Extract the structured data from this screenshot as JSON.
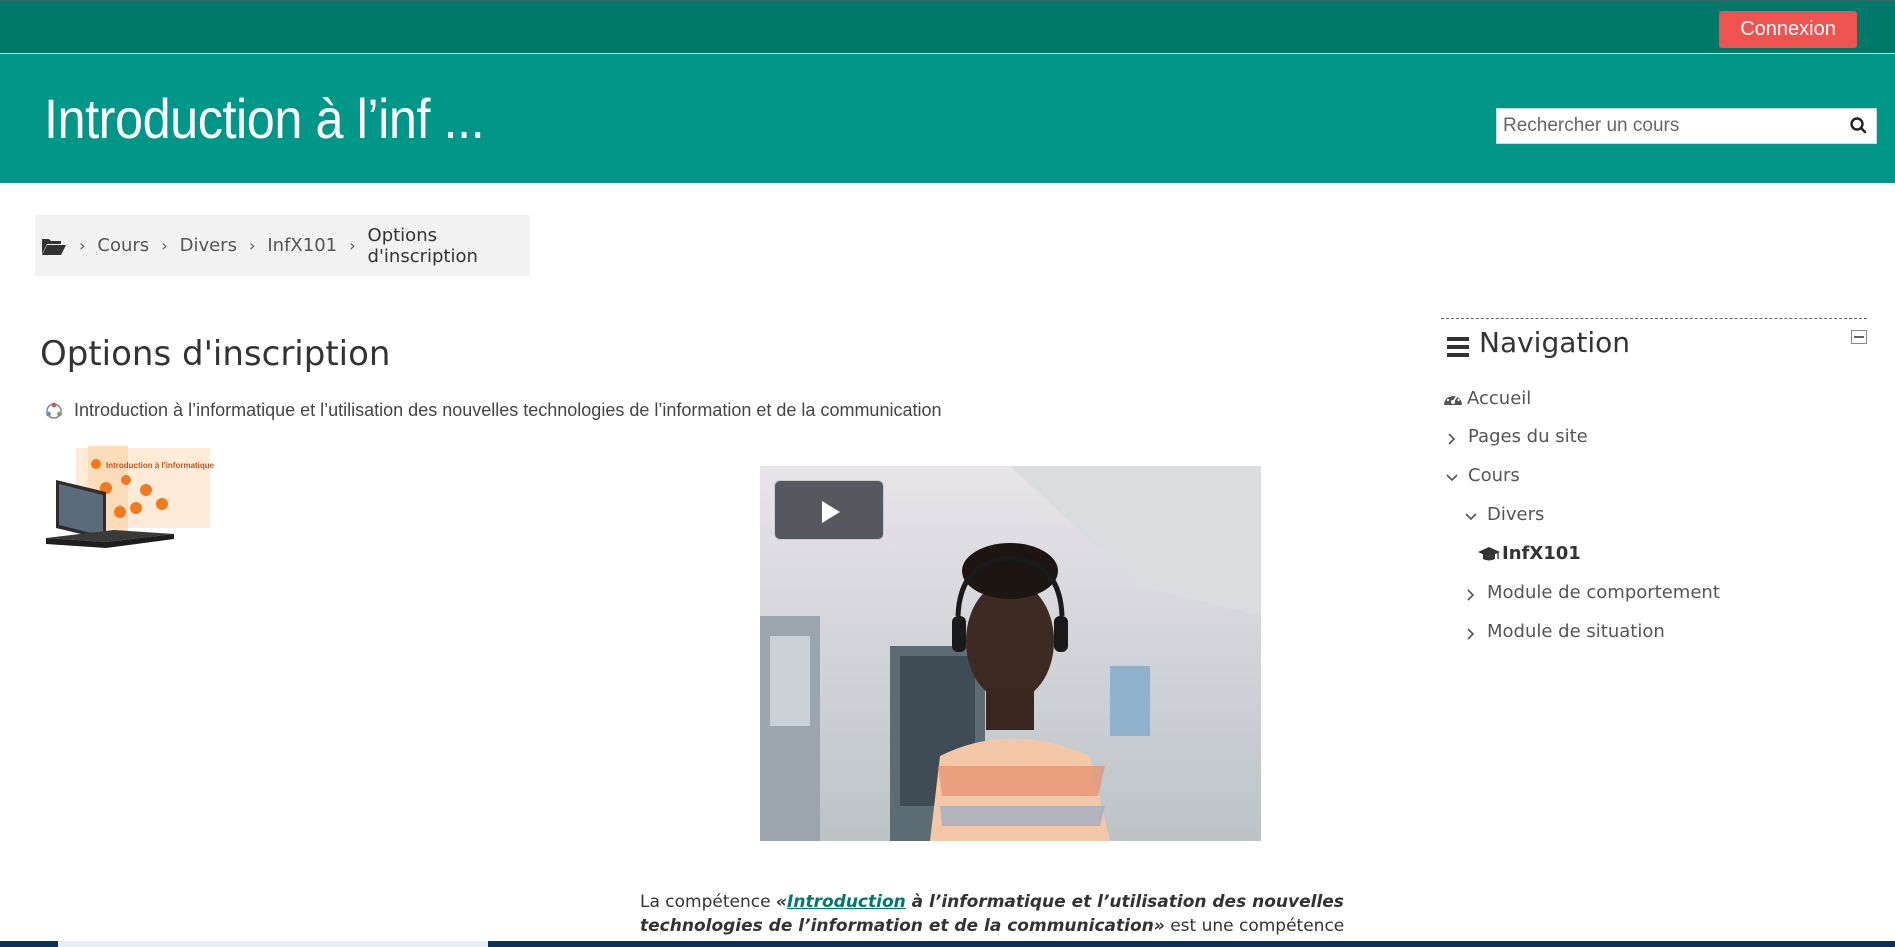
{
  "topbar": {
    "login_label": "Connexion"
  },
  "header": {
    "course_title": "Introduction à l’inf ...",
    "search_placeholder": "Rechercher un cours"
  },
  "breadcrumb": {
    "items": [
      "Cours",
      "Divers",
      "InfX101"
    ],
    "current": "Options d'inscription"
  },
  "main": {
    "heading": "Options d'inscription",
    "course_name": "Introduction à l’informatique et l’utilisation des nouvelles technologies de l’information et de la communication",
    "description": {
      "prefix": "La compétence ",
      "open_quote": "«",
      "link_word": "Introduction",
      "bold_rest": " à l’informatique et l’utilisation des nouvelles technologies de l’information et de la communication",
      "close_quote": "»",
      "suffix": " est une compétence particulière que l’on retrouve"
    }
  },
  "navigation": {
    "title": "Navigation",
    "items": [
      {
        "label": "Accueil"
      },
      {
        "label": "Pages du site"
      },
      {
        "label": "Cours"
      },
      {
        "label": "Divers"
      },
      {
        "label": "InfX101"
      },
      {
        "label": "Module de comportement"
      },
      {
        "label": "Module de situation"
      }
    ]
  },
  "colors": {
    "topbar": "#00796b",
    "header": "#009688",
    "login_button": "#ef5350",
    "link": "#00796b"
  },
  "icons": {
    "breadcrumb_home": "folder-open-icon",
    "search": "search-icon",
    "nav_menu": "bars-icon",
    "collapse": "collapse-icon",
    "accueil": "dashboard-icon",
    "course": "graduation-cap-icon",
    "video_play": "play-icon"
  }
}
